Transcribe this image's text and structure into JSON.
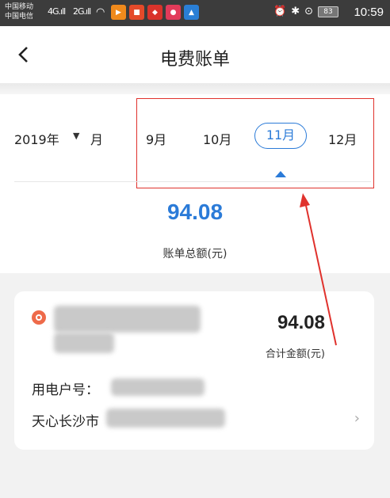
{
  "status_bar": {
    "carrier_1": "中国移动",
    "carrier_2": "中国电信",
    "signal_1": "4G",
    "signal_2": "2G",
    "battery": "83",
    "time": "10:59"
  },
  "header": {
    "title": "电费账单",
    "back_icon": "chevron-left-icon"
  },
  "month_selector": {
    "year": "2019年",
    "month_label": "月",
    "months": [
      "9月",
      "10月",
      "11月",
      "12月"
    ],
    "selected_month": "11月"
  },
  "summary": {
    "total": "94.08",
    "total_label": "账单总额(元)"
  },
  "bill_card": {
    "amount": "94.08",
    "amount_label": "合计金额(元)",
    "account_label": "用电户号：",
    "address_label": "天心长沙市",
    "chevron": "›"
  },
  "colors": {
    "accent_blue": "#2b7bd8",
    "annotation_red": "#e0322d",
    "logo_orange": "#ee6a4a"
  }
}
